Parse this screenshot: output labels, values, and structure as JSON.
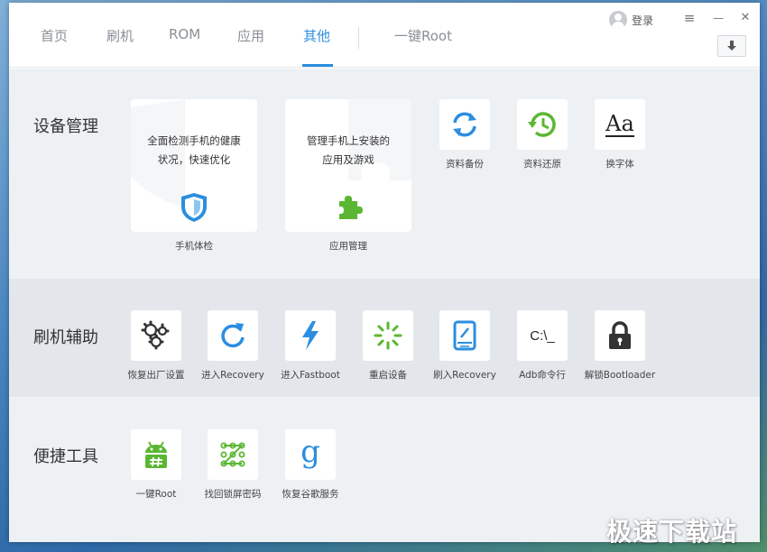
{
  "tabs": [
    "首页",
    "刷机",
    "ROM",
    "应用",
    "其他",
    "一键Root"
  ],
  "active_tab": "其他",
  "header": {
    "login_label": "登录",
    "menu_icon": "≡",
    "minimize_icon": "—",
    "close_icon": "✕"
  },
  "device_management": {
    "title": "设备管理",
    "cards": [
      {
        "desc_line1": "全面检测手机的健康",
        "desc_line2": "状况，快速优化",
        "label": "手机体检",
        "icon": "shield-icon"
      },
      {
        "desc_line1": "管理手机上安装的",
        "desc_line2": "应用及游戏",
        "label": "应用管理",
        "icon": "puzzle-icon"
      }
    ],
    "tools": [
      {
        "label": "资料备份",
        "icon": "sync-icon"
      },
      {
        "label": "资料还原",
        "icon": "restore-icon"
      },
      {
        "label": "换字体",
        "icon": "font-icon",
        "glyph": "Aa"
      }
    ]
  },
  "flash_assist": {
    "title": "刷机辅助",
    "tools": [
      {
        "label": "恢复出厂设置",
        "icon": "gears-icon"
      },
      {
        "label": "进入Recovery",
        "icon": "refresh-icon"
      },
      {
        "label": "进入Fastboot",
        "icon": "lightning-icon"
      },
      {
        "label": "重启设备",
        "icon": "spinner-icon"
      },
      {
        "label": "刷入Recovery",
        "icon": "tablet-icon"
      },
      {
        "label": "Adb命令行",
        "icon": "terminal-icon",
        "glyph": "C:\\_"
      },
      {
        "label": "解锁Bootloader",
        "icon": "lock-icon"
      }
    ]
  },
  "quick_tools": {
    "title": "便捷工具",
    "tools": [
      {
        "label": "一键Root",
        "icon": "android-icon"
      },
      {
        "label": "找回锁屏密码",
        "icon": "pattern-lock-icon"
      },
      {
        "label": "恢复谷歌服务",
        "icon": "google-icon",
        "glyph": "g"
      }
    ]
  },
  "site_watermark": "极速下载站",
  "colors": {
    "accent": "#2b8ee0",
    "green": "#5bb733",
    "dark": "#333333"
  }
}
